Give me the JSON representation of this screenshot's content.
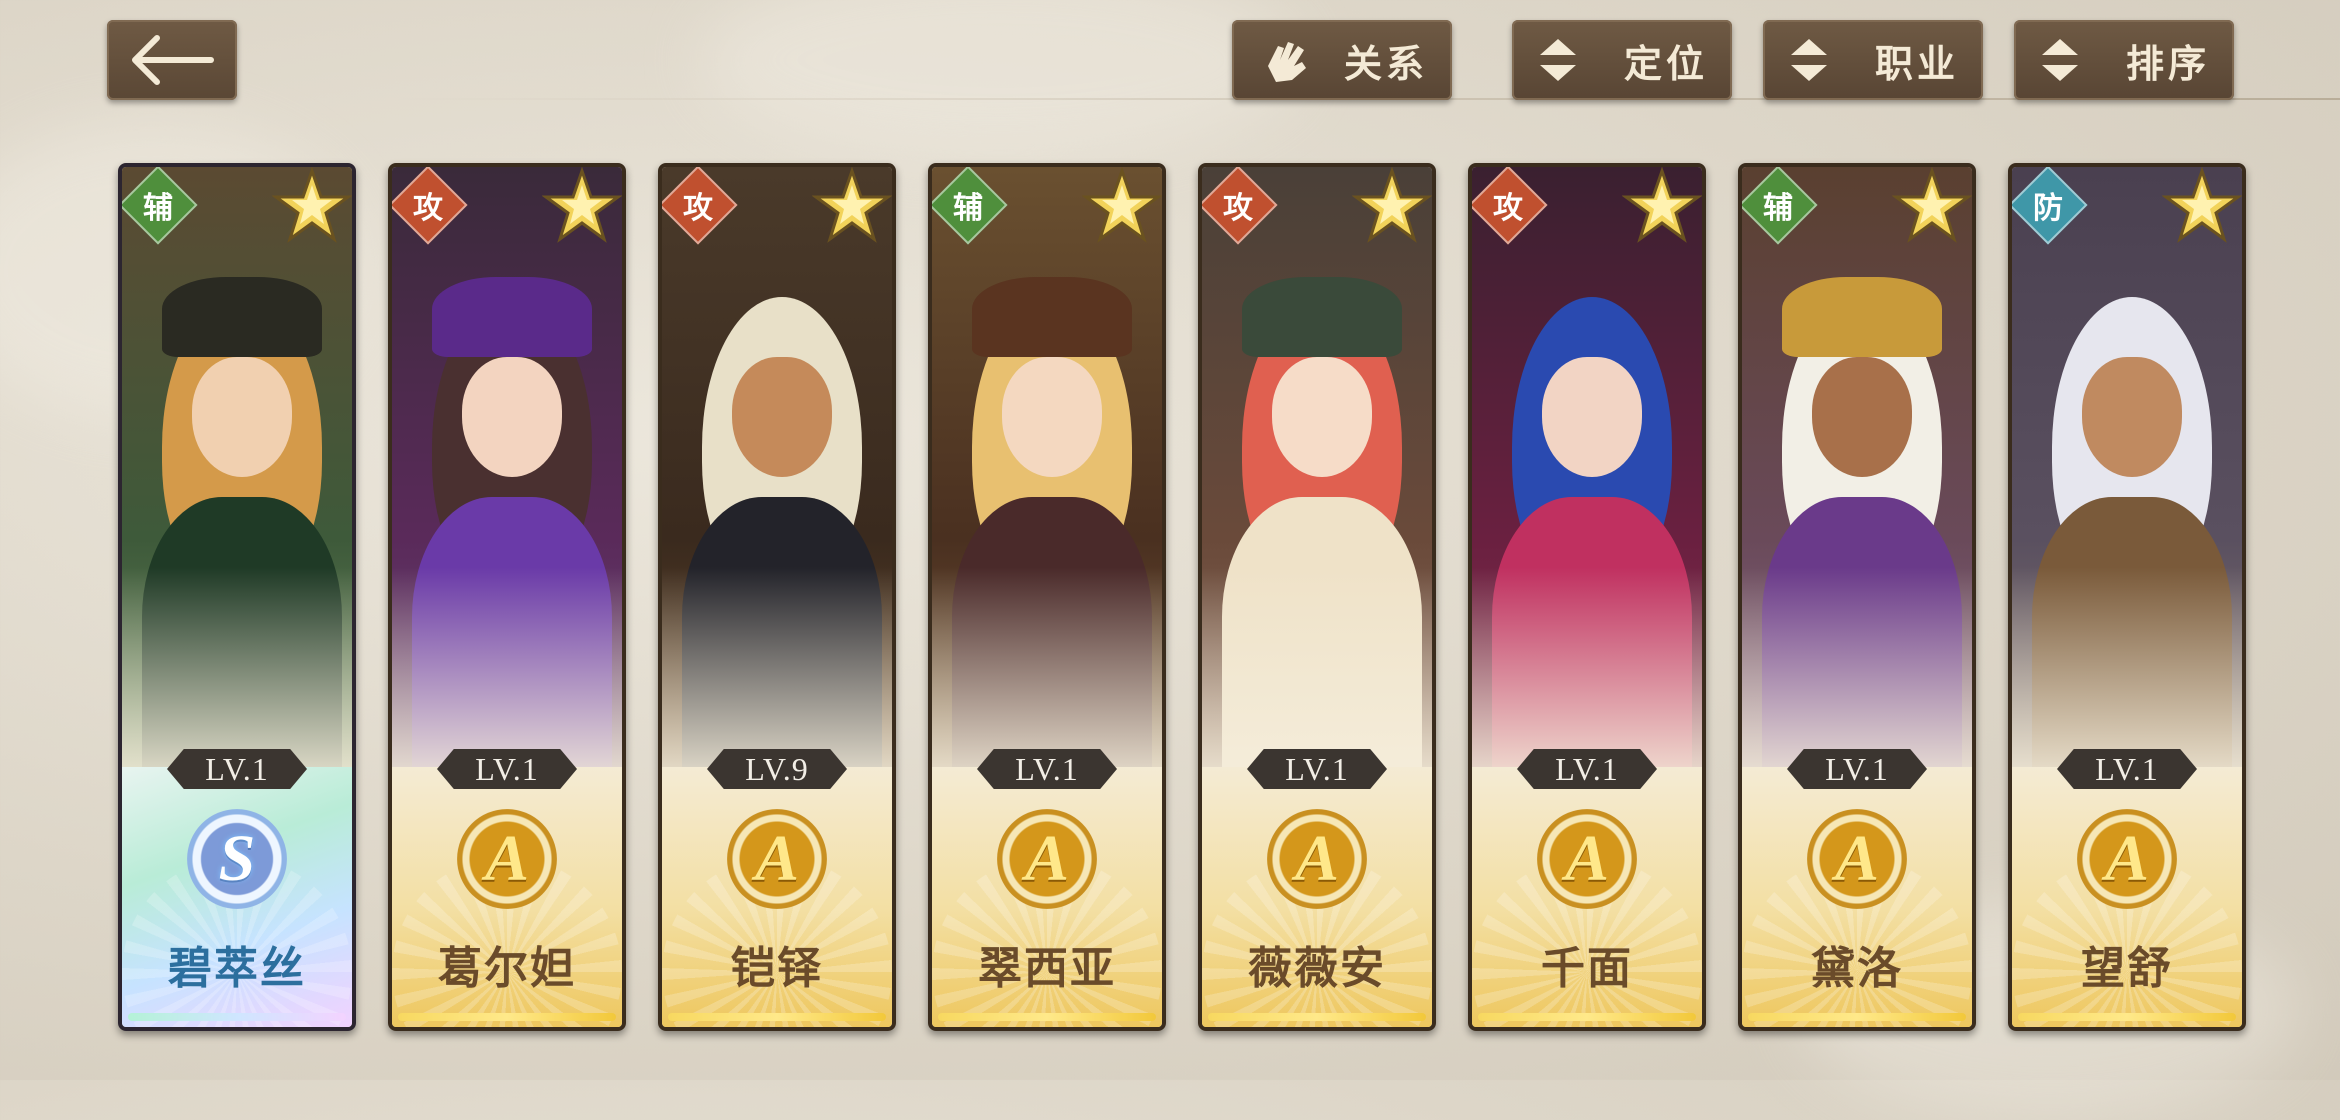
{
  "toolbar": {
    "relation_label": "关系",
    "position_label": "定位",
    "class_label": "职业",
    "sort_label": "排序"
  },
  "colors": {
    "button_bg": "#5f4b39",
    "button_text": "#f4ead6",
    "role_support": "#4f8f3c",
    "role_attack": "#c0502f",
    "role_defense": "#3f97a8",
    "grade_gold": "#d4971b",
    "grade_s": "#7d9ad8"
  },
  "heroes": [
    {
      "name": "碧萃丝",
      "role": "辅",
      "role_type": "support",
      "level": "LV.1",
      "grade": "S",
      "frame": "rainbow",
      "star_icon": "star-icon"
    },
    {
      "name": "葛尔妲",
      "role": "攻",
      "role_type": "attack",
      "level": "LV.1",
      "grade": "A",
      "frame": "gold",
      "star_icon": "star-icon"
    },
    {
      "name": "铠铎",
      "role": "攻",
      "role_type": "attack",
      "level": "LV.9",
      "grade": "A",
      "frame": "gold",
      "star_icon": "star-icon"
    },
    {
      "name": "翠西亚",
      "role": "辅",
      "role_type": "support",
      "level": "LV.1",
      "grade": "A",
      "frame": "gold",
      "star_icon": "star-icon"
    },
    {
      "name": "薇薇安",
      "role": "攻",
      "role_type": "attack",
      "level": "LV.1",
      "grade": "A",
      "frame": "gold",
      "star_icon": "star-icon"
    },
    {
      "name": "千面",
      "role": "攻",
      "role_type": "attack",
      "level": "LV.1",
      "grade": "A",
      "frame": "gold",
      "star_icon": "star-icon"
    },
    {
      "name": "黛洛",
      "role": "辅",
      "role_type": "support",
      "level": "LV.1",
      "grade": "A",
      "frame": "gold",
      "star_icon": "star-icon"
    },
    {
      "name": "望舒",
      "role": "防",
      "role_type": "defense",
      "level": "LV.1",
      "grade": "A",
      "frame": "gold",
      "star_icon": "star-icon"
    }
  ]
}
